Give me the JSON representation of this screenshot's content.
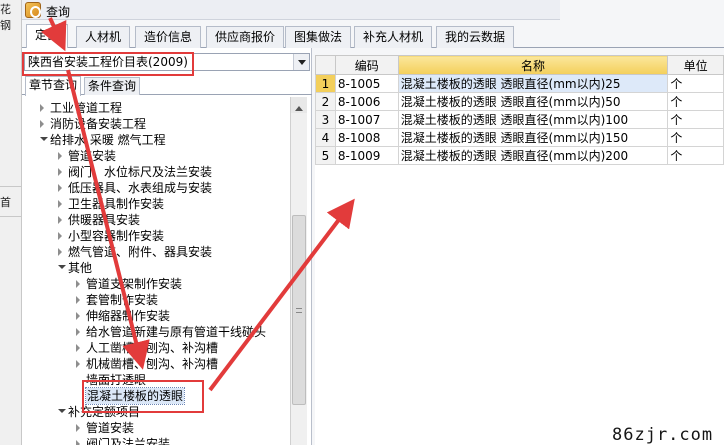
{
  "background": {
    "left_texts": [
      "花",
      "钢",
      "首"
    ]
  },
  "window": {
    "title": "查询"
  },
  "tabs": [
    {
      "label": "定额"
    },
    {
      "label": "人材机"
    },
    {
      "label": "造价信息"
    },
    {
      "label": "供应商报价"
    },
    {
      "label": "图集做法"
    },
    {
      "label": "补充人材机"
    },
    {
      "label": "我的云数据"
    }
  ],
  "library_select": {
    "value": "陕西省安装工程价目表(2009)"
  },
  "subtabs": [
    {
      "label": "章节查询"
    },
    {
      "label": "条件查询"
    }
  ],
  "tree": [
    {
      "label": "工业管道工程"
    },
    {
      "label": "消防设备安装工程"
    },
    {
      "label": "给排水 采暖 燃气工程"
    },
    {
      "label": "管道安装"
    },
    {
      "label": "阀门、水位标尺及法兰安装"
    },
    {
      "label": "低压器具、水表组成与安装"
    },
    {
      "label": "卫生器具制作安装"
    },
    {
      "label": "供暖器具安装"
    },
    {
      "label": "小型容器制作安装"
    },
    {
      "label": "燃气管道、附件、器具安装"
    },
    {
      "label": "其他"
    },
    {
      "label": "管道支架制作安装"
    },
    {
      "label": "套管制作安装"
    },
    {
      "label": "伸缩器制作安装"
    },
    {
      "label": "给水管道新建与原有管道干线碰头"
    },
    {
      "label": "人工凿槽、刨沟、补沟槽"
    },
    {
      "label": "机械凿槽、刨沟、补沟槽"
    },
    {
      "label": "墙面打透眼"
    },
    {
      "label": "混凝土楼板的透眼"
    },
    {
      "label": "补充定额项目"
    },
    {
      "label": "管道安装"
    },
    {
      "label": "阀门及法兰安装"
    }
  ],
  "table": {
    "headers": {
      "code": "编码",
      "name": "名称",
      "unit": "单位"
    },
    "rows": [
      {
        "no": "1",
        "code": "8-1005",
        "name": "混凝土楼板的透眼 透眼直径(mm以内)25",
        "unit": "个"
      },
      {
        "no": "2",
        "code": "8-1006",
        "name": "混凝土楼板的透眼 透眼直径(mm以内)50",
        "unit": "个"
      },
      {
        "no": "3",
        "code": "8-1007",
        "name": "混凝土楼板的透眼 透眼直径(mm以内)100",
        "unit": "个"
      },
      {
        "no": "4",
        "code": "8-1008",
        "name": "混凝土楼板的透眼 透眼直径(mm以内)150",
        "unit": "个"
      },
      {
        "no": "5",
        "code": "8-1009",
        "name": "混凝土楼板的透眼 透眼直径(mm以内)200",
        "unit": "个"
      }
    ]
  },
  "watermark": "86zjr.com",
  "colors": {
    "annotation_red": "#e23b3b",
    "header_highlight": "#f3cf5b",
    "selection": "#dbe7f7"
  }
}
